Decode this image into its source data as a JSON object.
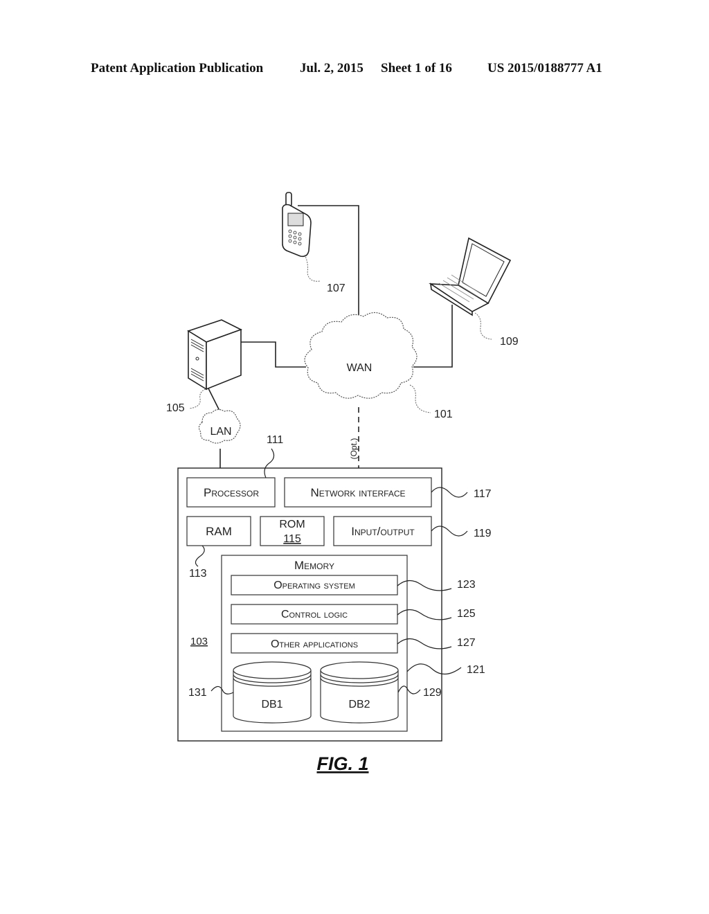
{
  "header": {
    "publication": "Patent Application Publication",
    "date": "Jul. 2, 2015",
    "sheet": "Sheet 1 of 16",
    "number": "US 2015/0188777 A1"
  },
  "figure": {
    "caption": "FIG. 1",
    "network": {
      "wan_label": "WAN",
      "lan_label": "LAN",
      "optional_label": "(Opt.)"
    },
    "references": {
      "wan": "101",
      "device": "103",
      "server": "105",
      "phone": "107",
      "laptop": "109",
      "processor": "111",
      "ram": "113",
      "rom": "115",
      "network_interface": "117",
      "io": "119",
      "memory": "121",
      "os": "123",
      "control_logic": "125",
      "other_apps": "127",
      "db2": "129",
      "db1": "131"
    },
    "blocks": {
      "processor": "Processor",
      "network_interface": "Network interface",
      "ram": "RAM",
      "rom": "ROM",
      "io": "Input/output",
      "memory": "Memory",
      "os": "Operating system",
      "control_logic": "Control logic",
      "other_apps": "Other applications",
      "db1": "DB1",
      "db2": "DB2"
    }
  }
}
